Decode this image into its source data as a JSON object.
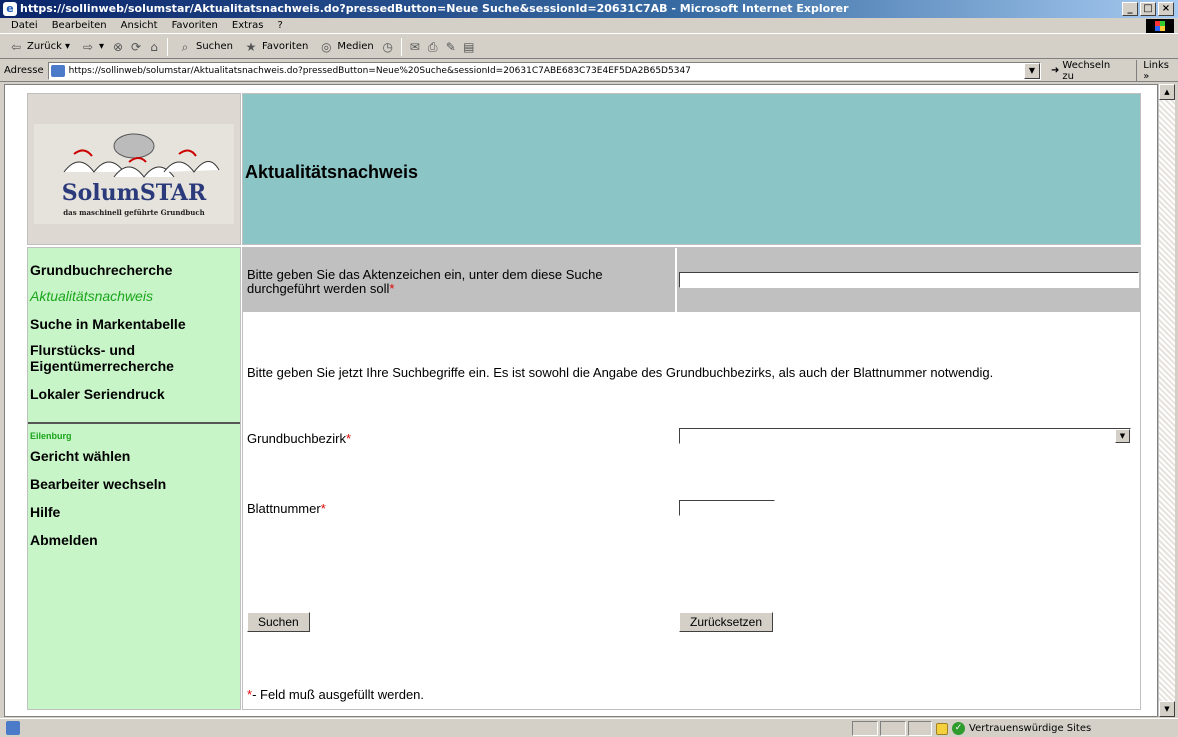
{
  "window": {
    "title": "https://sollinweb/solumstar/Aktualitatsnachweis.do?pressedButton=Neue Suche&sessionId=20631C7AB - Microsoft Internet Explorer",
    "controls": [
      "_",
      "□",
      "×"
    ]
  },
  "menubar": [
    "Datei",
    "Bearbeiten",
    "Ansicht",
    "Favoriten",
    "Extras",
    "?"
  ],
  "toolbar": {
    "back_label": "Zurück",
    "search_label": "Suchen",
    "favorites_label": "Favoriten",
    "media_label": "Medien"
  },
  "addressbar": {
    "label": "Adresse",
    "url": "https://sollinweb/solumstar/Aktualitatsnachweis.do?pressedButton=Neue%20Suche&sessionId=20631C7ABE683C73E4EF5DA2B65D5347",
    "go_label": "Wechseln zu",
    "links_label": "Links »"
  },
  "logo": {
    "title": "SolumSTAR",
    "subtitle": "das maschinell geführte Grundbuch"
  },
  "header": {
    "title": "Aktualitätsnachweis"
  },
  "sidebar": {
    "items": [
      {
        "label": "Grundbuchrecherche"
      },
      {
        "label": "Aktualitätsnachweis"
      },
      {
        "label": "Suche in Markentabelle"
      },
      {
        "label": "Flurstücks- und Eigentümerrecherche"
      },
      {
        "label": "Lokaler Seriendruck"
      }
    ],
    "court": "Eilenburg",
    "bottom_items": [
      {
        "label": "Gericht wählen"
      },
      {
        "label": "Bearbeiter wechseln"
      },
      {
        "label": "Hilfe"
      },
      {
        "label": "Abmelden"
      }
    ]
  },
  "form": {
    "aktenzeichen_label": "Bitte geben Sie das Aktenzeichen ein, unter dem diese Suche durchgeführt werden soll",
    "required_mark": "*",
    "aktenzeichen_value": "",
    "instructions": "Bitte geben Sie jetzt Ihre Suchbegriffe ein. Es ist sowohl die Angabe des Grundbuchbezirks, als auch der Blattnummer notwendig.",
    "grundbuchbezirk_label": "Grundbuchbezirk",
    "grundbuchbezirk_value": "",
    "blattnummer_label": "Blattnummer",
    "blattnummer_value": "",
    "search_button": "Suchen",
    "reset_button": "Zurücksetzen",
    "footnote": "- Feld muß ausgefüllt werden."
  },
  "statusbar": {
    "zone": "Vertrauenswürdige Sites"
  }
}
